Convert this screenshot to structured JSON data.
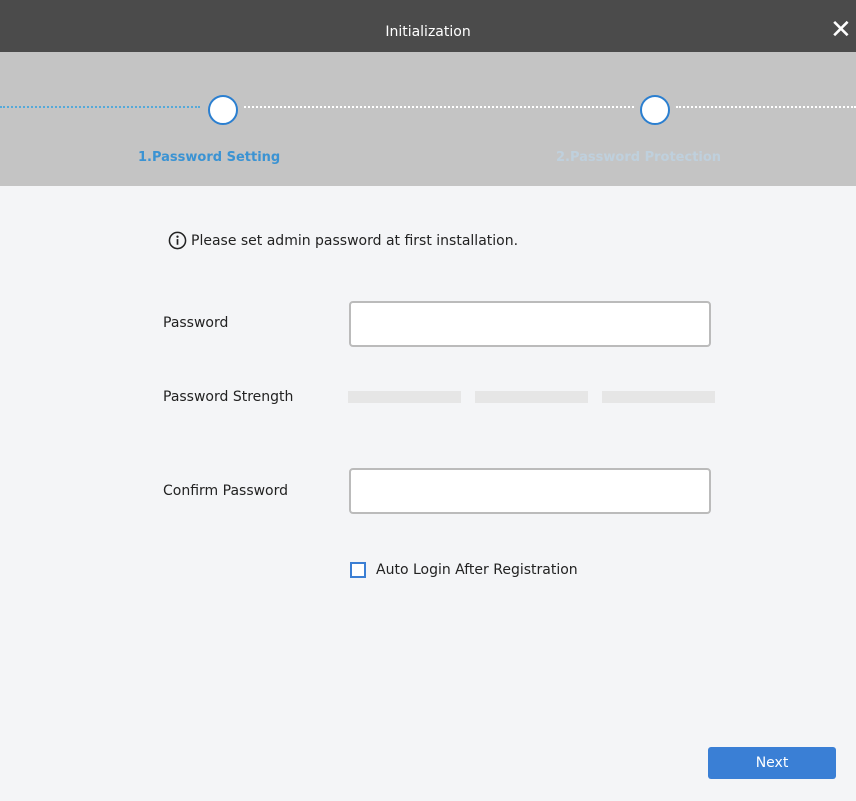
{
  "window": {
    "title": "Initialization",
    "close_icon": "close-icon"
  },
  "steps": [
    {
      "label": "1.Password Setting",
      "active": true
    },
    {
      "label": "2.Password Protection",
      "active": false
    }
  ],
  "info": {
    "icon": "info-icon",
    "text": "Please set admin password at first installation."
  },
  "form": {
    "password_label": "Password",
    "password_value": "",
    "strength_label": "Password Strength",
    "strength_level": 0,
    "confirm_label": "Confirm Password",
    "confirm_value": "",
    "auto_login_label": "Auto Login After Registration",
    "auto_login_checked": false
  },
  "buttons": {
    "next": "Next"
  },
  "colors": {
    "titlebar": "#4b4b4b",
    "stepper": "#c4c4c4",
    "accent": "#3a7fd5",
    "step_active": "#3b93d3",
    "step_inactive": "#bfd0dd",
    "background": "#f4f5f7"
  }
}
